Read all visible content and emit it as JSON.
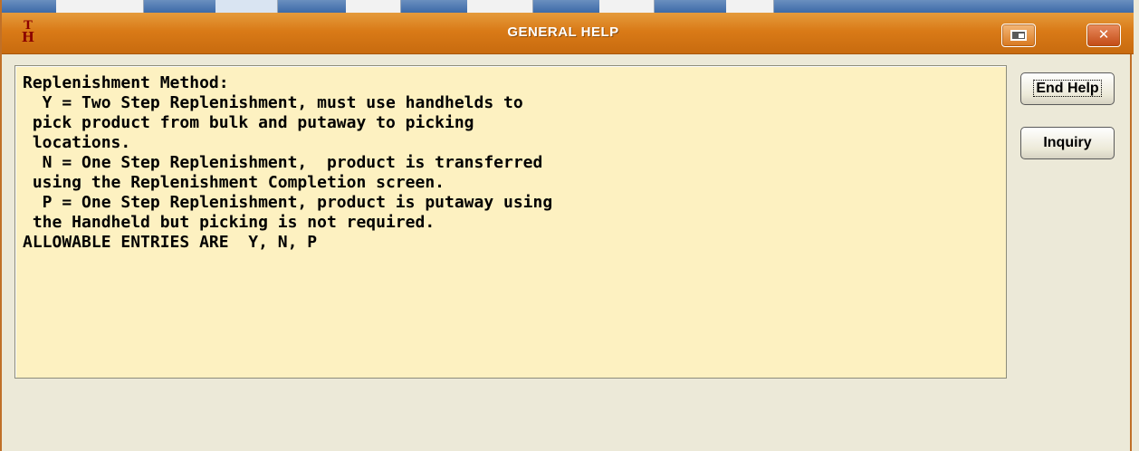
{
  "window": {
    "title": "GENERAL HELP",
    "icon": "app-logo-icon",
    "icon_letters_top": "T",
    "icon_letters_bottom": "H"
  },
  "titlebar_buttons": {
    "restore_icon": "restore-icon",
    "close_glyph": "✕"
  },
  "help": {
    "text": "Replenishment Method:\n  Y = Two Step Replenishment, must use handhelds to\n pick product from bulk and putaway to picking\n locations.\n  N = One Step Replenishment,  product is transferred\n using the Replenishment Completion screen.\n  P = One Step Replenishment, product is putaway using\n the Handheld but picking is not required.\nALLOWABLE ENTRIES ARE  Y, N, P"
  },
  "buttons": {
    "end_help": "End Help",
    "inquiry": "Inquiry"
  },
  "colors": {
    "titlebar": "#d97a17",
    "help_background": "#fdf1c1",
    "window_background": "#ece9d8"
  }
}
